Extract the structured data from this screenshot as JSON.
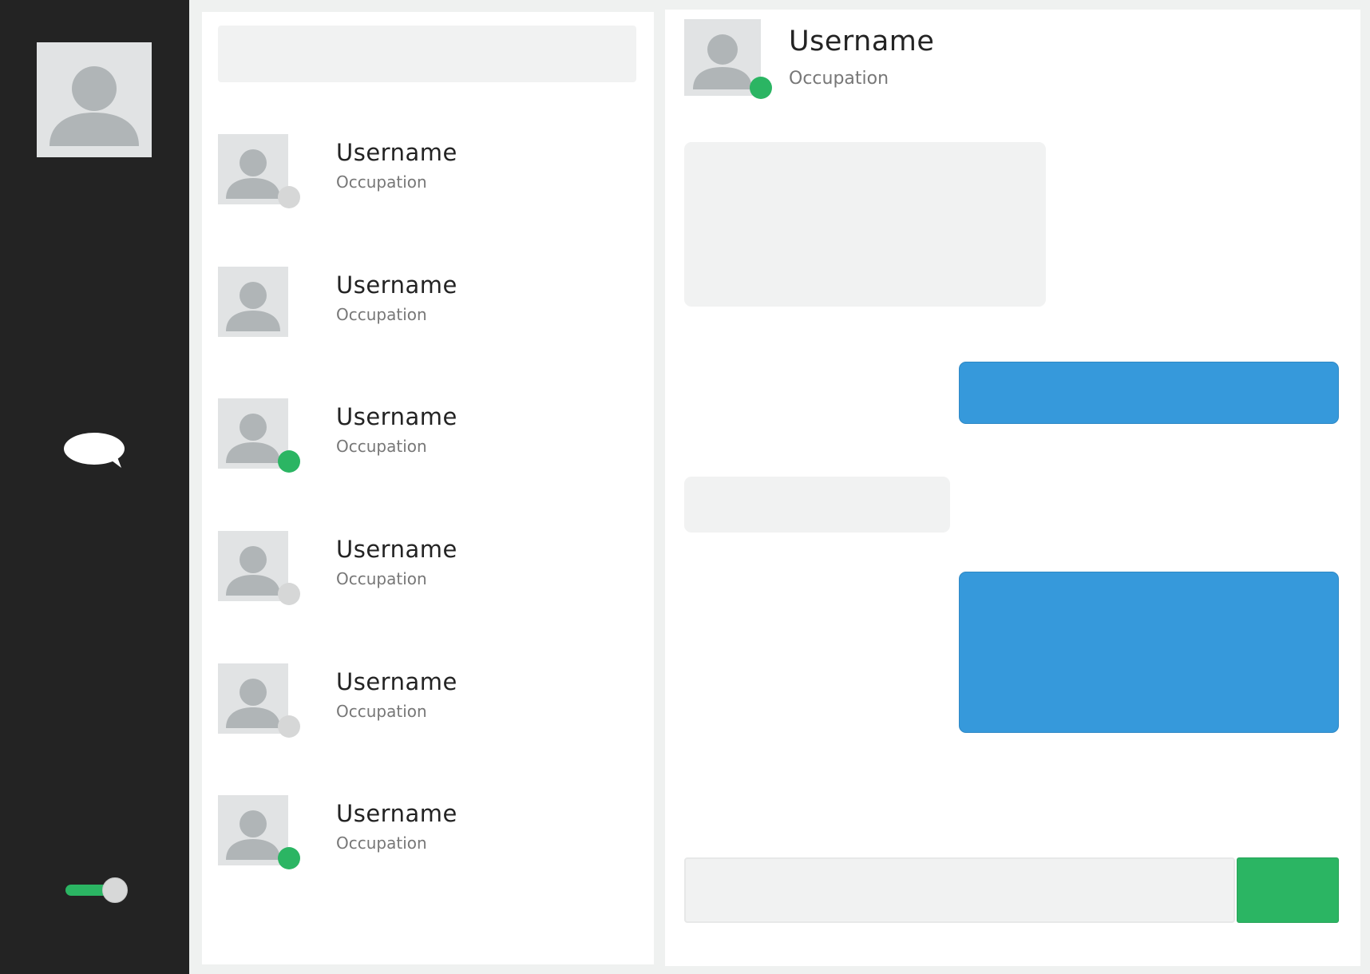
{
  "colors": {
    "sidebar_bg": "#232323",
    "accent_green": "#2bb563",
    "outgoing_bubble": "#3699db",
    "incoming_bubble": "#f1f2f2",
    "offline_status": "#d6d7d7"
  },
  "sidebar": {
    "profile_icon": "user-avatar-icon",
    "nav_icon": "chat-bubble-icon",
    "toggle": {
      "state": "on"
    }
  },
  "search": {
    "placeholder": ""
  },
  "contacts": [
    {
      "username": "Username",
      "occupation": "Occupation",
      "status": "offline"
    },
    {
      "username": "Username",
      "occupation": "Occupation",
      "status": "none"
    },
    {
      "username": "Username",
      "occupation": "Occupation",
      "status": "online"
    },
    {
      "username": "Username",
      "occupation": "Occupation",
      "status": "offline"
    },
    {
      "username": "Username",
      "occupation": "Occupation",
      "status": "offline"
    },
    {
      "username": "Username",
      "occupation": "Occupation",
      "status": "online"
    }
  ],
  "chat": {
    "username": "Username",
    "occupation": "Occupation",
    "status": "online",
    "messages": [
      {
        "direction": "incoming",
        "text": ""
      },
      {
        "direction": "outgoing",
        "text": ""
      },
      {
        "direction": "incoming",
        "text": ""
      },
      {
        "direction": "outgoing",
        "text": ""
      }
    ],
    "input_placeholder": "",
    "send_label": ""
  }
}
